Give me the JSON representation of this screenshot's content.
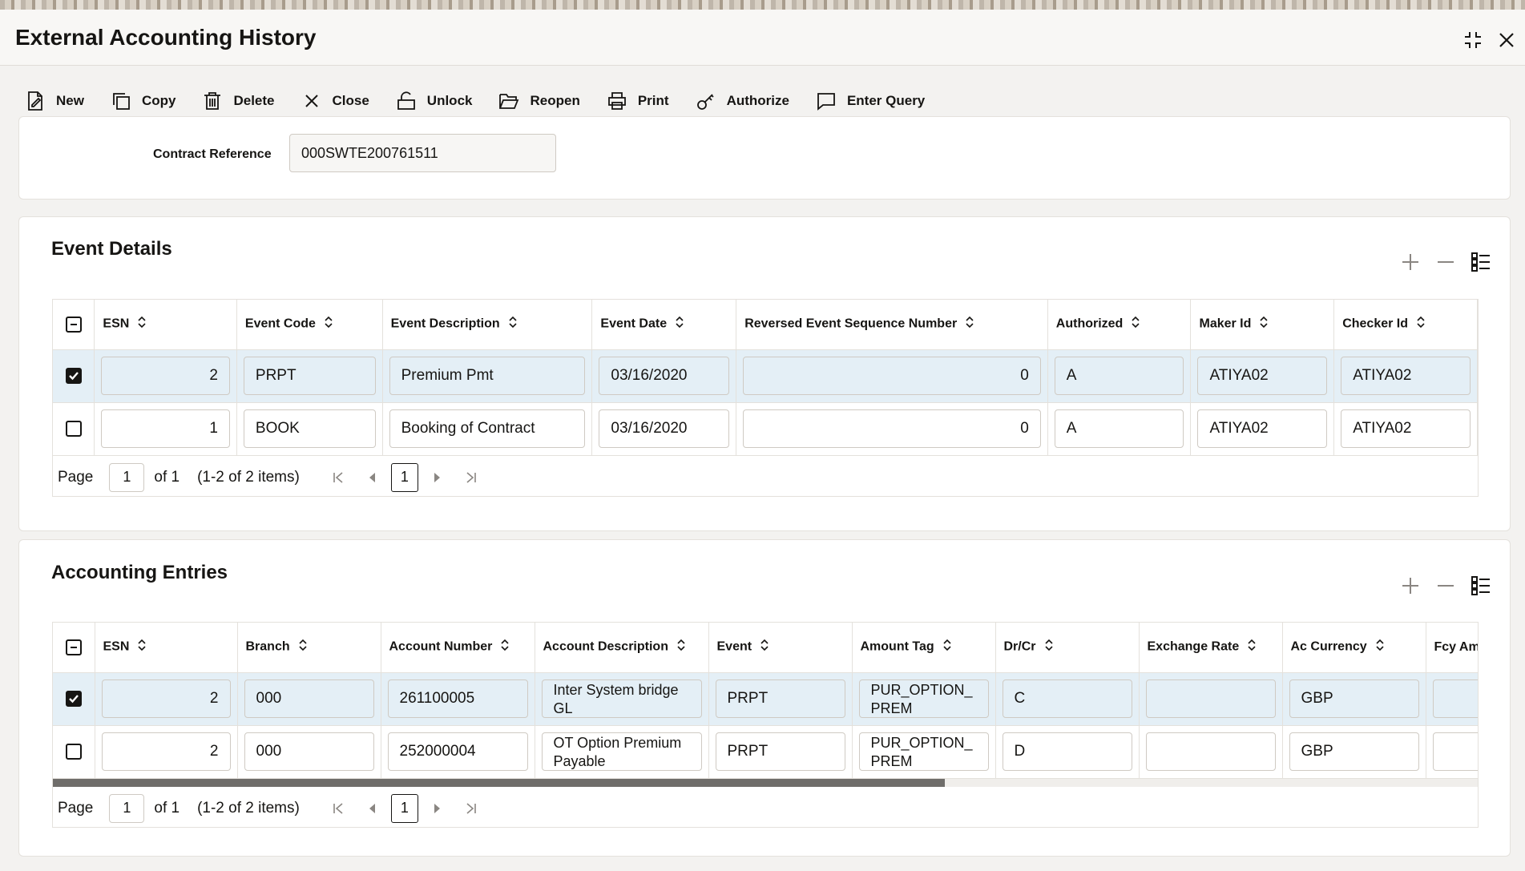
{
  "window": {
    "title": "External Accounting History"
  },
  "toolbar": [
    {
      "label": "New",
      "icon": "new-document-icon"
    },
    {
      "label": "Copy",
      "icon": "copy-icon"
    },
    {
      "label": "Delete",
      "icon": "trash-icon"
    },
    {
      "label": "Close",
      "icon": "x-icon"
    },
    {
      "label": "Unlock",
      "icon": "unlock-icon"
    },
    {
      "label": "Reopen",
      "icon": "folder-open-icon"
    },
    {
      "label": "Print",
      "icon": "printer-icon"
    },
    {
      "label": "Authorize",
      "icon": "key-icon"
    },
    {
      "label": "Enter Query",
      "icon": "comment-icon"
    }
  ],
  "contract": {
    "label": "Contract Reference",
    "value": "000SWTE200761511"
  },
  "event_details": {
    "title": "Event Details",
    "columns": [
      "ESN",
      "Event Code",
      "Event Description",
      "Event Date",
      "Reversed Event Sequence Number",
      "Authorized",
      "Maker Id",
      "Checker Id"
    ],
    "rows": [
      {
        "selected": true,
        "esn": "2",
        "code": "PRPT",
        "desc": "Premium Pmt",
        "date": "03/16/2020",
        "rev": "0",
        "auth": "A",
        "maker": "ATIYA02",
        "checker": "ATIYA02"
      },
      {
        "selected": false,
        "esn": "1",
        "code": "BOOK",
        "desc": "Booking of Contract",
        "date": "03/16/2020",
        "rev": "0",
        "auth": "A",
        "maker": "ATIYA02",
        "checker": "ATIYA02"
      }
    ],
    "pager": {
      "page_label": "Page",
      "page": "1",
      "of": "of 1",
      "items": "(1-2 of 2 items)",
      "current": "1"
    }
  },
  "accounting_entries": {
    "title": "Accounting Entries",
    "columns": [
      "ESN",
      "Branch",
      "Account Number",
      "Account Description",
      "Event",
      "Amount Tag",
      "Dr/Cr",
      "Exchange Rate",
      "Ac Currency",
      "Fcy Amc"
    ],
    "rows": [
      {
        "selected": true,
        "esn": "2",
        "branch": "000",
        "acct": "261100005",
        "desc": "Inter System bridge GL",
        "event": "PRPT",
        "tag": "PUR_OPTION_ PREM",
        "drcr": "C",
        "rate": "",
        "ccy": "GBP",
        "fcy": ""
      },
      {
        "selected": false,
        "esn": "2",
        "branch": "000",
        "acct": "252000004",
        "desc": "OT Option Premium Payable",
        "event": "PRPT",
        "tag": "PUR_OPTION_ PREM",
        "drcr": "D",
        "rate": "",
        "ccy": "GBP",
        "fcy": ""
      }
    ],
    "pager": {
      "page_label": "Page",
      "page": "1",
      "of": "of 1",
      "items": "(1-2 of 2 items)",
      "current": "1"
    }
  }
}
